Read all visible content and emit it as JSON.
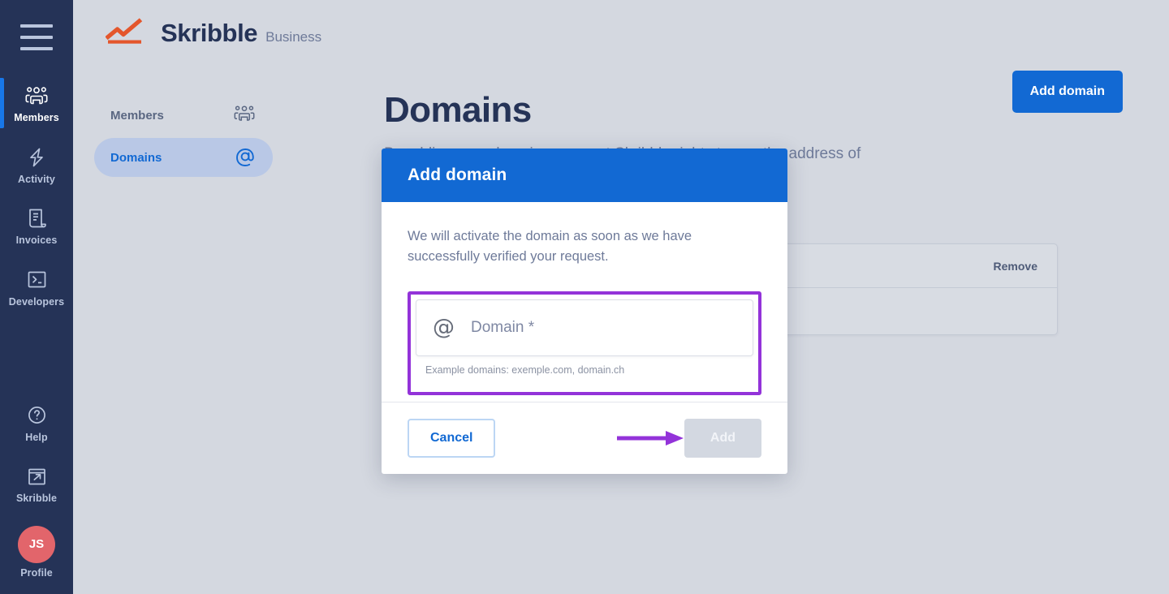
{
  "colors": {
    "rail_bg": "#253357",
    "page_bg": "#d4d8e0",
    "accent_blue": "#1269d3",
    "active_indicator": "#1877e8",
    "annotation_purple": "#9333d9",
    "avatar_red": "#e2656b",
    "logo_orange": "#e4562c",
    "nav_pill": "#b9c8e6"
  },
  "rail": {
    "menu_icon": "hamburger-menu-icon",
    "items": [
      {
        "label": "Members",
        "icon": "members-group-icon",
        "active": true
      },
      {
        "label": "Activity",
        "icon": "lightning-bolt-icon",
        "active": false
      },
      {
        "label": "Invoices",
        "icon": "document-invoice-icon",
        "active": false
      },
      {
        "label": "Developers",
        "icon": "terminal-code-icon",
        "active": false
      }
    ],
    "bottom_items": [
      {
        "label": "Help",
        "icon": "question-circle-icon"
      },
      {
        "label": "Skribble",
        "icon": "external-link-icon"
      }
    ],
    "profile": {
      "label": "Profile",
      "initials": "JS"
    }
  },
  "brand": {
    "name": "Skribble",
    "suffix": "Business",
    "logo_icon": "skribble-chart-logo"
  },
  "secnav": {
    "items": [
      {
        "label": "Members",
        "icon": "members-group-icon",
        "active": false
      },
      {
        "label": "Domains",
        "icon": "at-sign-icon",
        "active": true
      }
    ]
  },
  "page": {
    "title": "Domains",
    "lead": "By adding your domain you grant Skribble rights to use the address of a  of your",
    "add_domain_button": "Add domain"
  },
  "table": {
    "headers": [
      "",
      "Remove"
    ],
    "rows": [
      {
        "cells": [
          "",
          ""
        ]
      }
    ]
  },
  "modal": {
    "title": "Add domain",
    "description": "We will activate the domain as soon as we have successfully verified your request.",
    "field": {
      "icon": "at-sign-icon",
      "placeholder": "Domain *",
      "value": "",
      "hint": "Example domains: exemple.com, domain.ch"
    },
    "cancel_label": "Cancel",
    "add_label": "Add"
  },
  "annotations": {
    "field_highlight": "purple-rectangle-highlight",
    "add_arrow": "purple-arrow-pointing-right"
  }
}
